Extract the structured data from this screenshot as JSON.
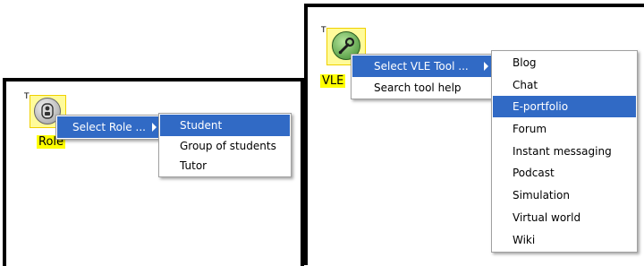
{
  "left": {
    "node_marker": "T",
    "node_label": "Role",
    "menu": {
      "select_label": "Select Role ..."
    },
    "submenu": {
      "items": [
        "Student",
        "Group of students",
        "Tutor"
      ],
      "selected": "Student"
    }
  },
  "right": {
    "node_marker": "T",
    "node_label": "VLE",
    "menu": {
      "select_label": "Select VLE Tool ...",
      "help_label": "Search tool help"
    },
    "submenu": {
      "items": [
        "Blog",
        "Chat",
        "E-portfolio",
        "Forum",
        "Instant messaging",
        "Podcast",
        "Simulation",
        "Virtual world",
        "Wiki"
      ],
      "selected": "E-portfolio"
    }
  },
  "colors": {
    "selection": "#316ac5",
    "node_highlight": "#ffff00",
    "frame": "#000000"
  },
  "icons": {
    "role_node": "person-icon",
    "vle_node": "wrench-icon",
    "submenu_arrow": "right-triangle-icon"
  }
}
